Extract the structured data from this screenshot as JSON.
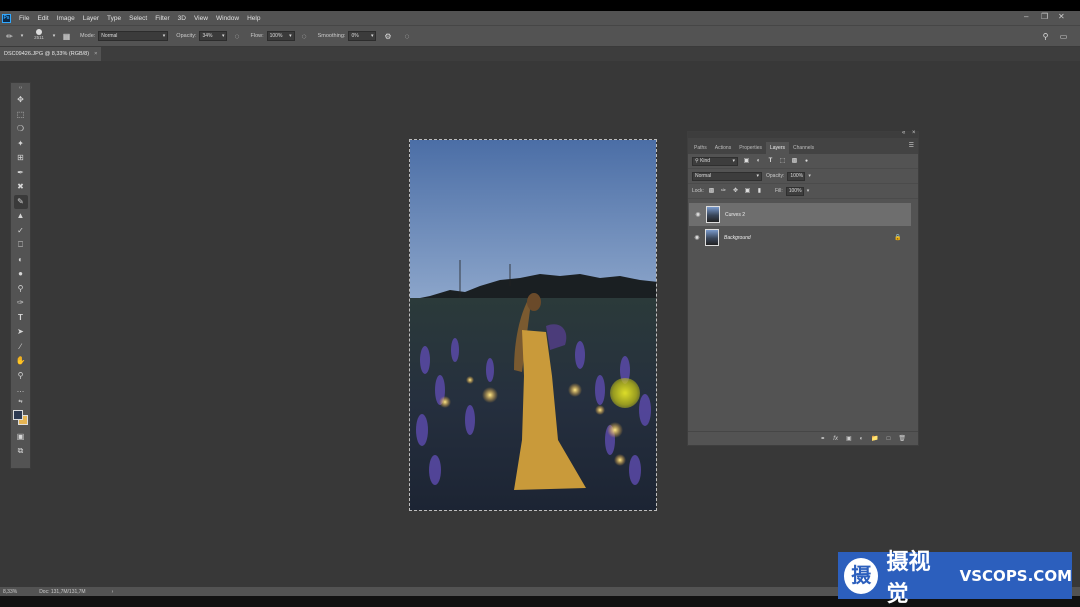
{
  "app": {
    "logo": "Ps"
  },
  "menu": {
    "items": [
      "File",
      "Edit",
      "Image",
      "Layer",
      "Type",
      "Select",
      "Filter",
      "3D",
      "View",
      "Window",
      "Help"
    ]
  },
  "options_bar": {
    "brush_size": "2511",
    "mode_label": "Mode:",
    "mode_value": "Normal",
    "opacity_label": "Opacity:",
    "opacity_value": "34%",
    "flow_label": "Flow:",
    "flow_value": "100%",
    "smoothing_label": "Smoothing:",
    "smoothing_value": "0%"
  },
  "document": {
    "tab_title": "DSC09426.JPG @ 8,33% (RGB/8)",
    "close": "×"
  },
  "tools": [
    "move-tool",
    "marquee-tool",
    "lasso-tool",
    "magic-wand-tool",
    "crop-tool",
    "eyedropper-tool",
    "healing-tool",
    "brush-tool",
    "stamp-tool",
    "history-brush-tool",
    "eraser-tool",
    "gradient-tool",
    "blur-tool",
    "dodge-tool",
    "pen-tool",
    "type-tool",
    "path-select-tool",
    "line-tool",
    "hand-tool",
    "zoom-tool",
    "more-tools"
  ],
  "colors": {
    "foreground": "#2e3b52",
    "background": "#e5b453",
    "accent": "#31a8ff"
  },
  "layers_panel": {
    "tabs": [
      "Paths",
      "Actions",
      "Properties",
      "Layers",
      "Channels"
    ],
    "active_tab": "Layers",
    "kind_label": "Kind",
    "blend_mode": "Normal",
    "opacity_label": "Opacity:",
    "opacity_value": "100%",
    "lock_label": "Lock:",
    "fill_label": "Fill:",
    "fill_value": "100%",
    "layers": [
      {
        "name": "Curves 2",
        "visible": true,
        "selected": true
      },
      {
        "name": "Background",
        "visible": true,
        "selected": false,
        "locked": true
      }
    ]
  },
  "status_bar": {
    "zoom": "8,33%",
    "doc_size": "Doc: 131,7M/131,7M"
  },
  "watermark": {
    "logo_char": "摄",
    "text_cn": "摄视觉",
    "text_en": "VSCOPS.COM"
  }
}
